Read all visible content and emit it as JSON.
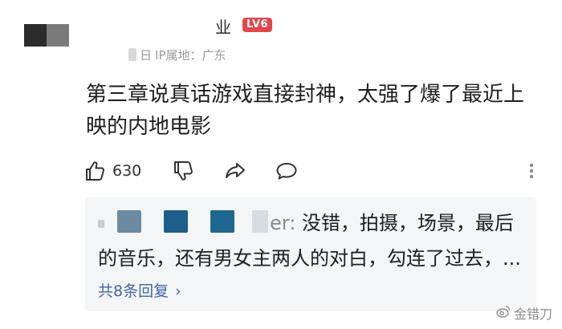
{
  "comment": {
    "author": {
      "name": "业",
      "level": "LV6"
    },
    "meta": {
      "date_partial": "日",
      "ip_location": "IP属地：广东"
    },
    "text_line1": "第三章说真话游戏直接封神，太强了爆了最近上",
    "text_line2": "映的内地电影",
    "likes": "630"
  },
  "replies": {
    "first_reply_suffix": "er:",
    "first_reply_text_line1": " 没错，拍摄，场景，最后",
    "first_reply_text_line2": "的音乐，还有男女主两人的对白，勾连了过去，...",
    "more_label": "共8条回复",
    "more_chevron": "›"
  },
  "watermark": {
    "text": "金错刀"
  },
  "colors": {
    "level_badge": "#e0464a",
    "link": "#3f66a6",
    "reply_box": "#f4f5f7"
  },
  "icons": [
    "thumbs-up-icon",
    "thumbs-down-icon",
    "share-icon",
    "comment-icon",
    "more-options-icon",
    "weibo-icon"
  ]
}
